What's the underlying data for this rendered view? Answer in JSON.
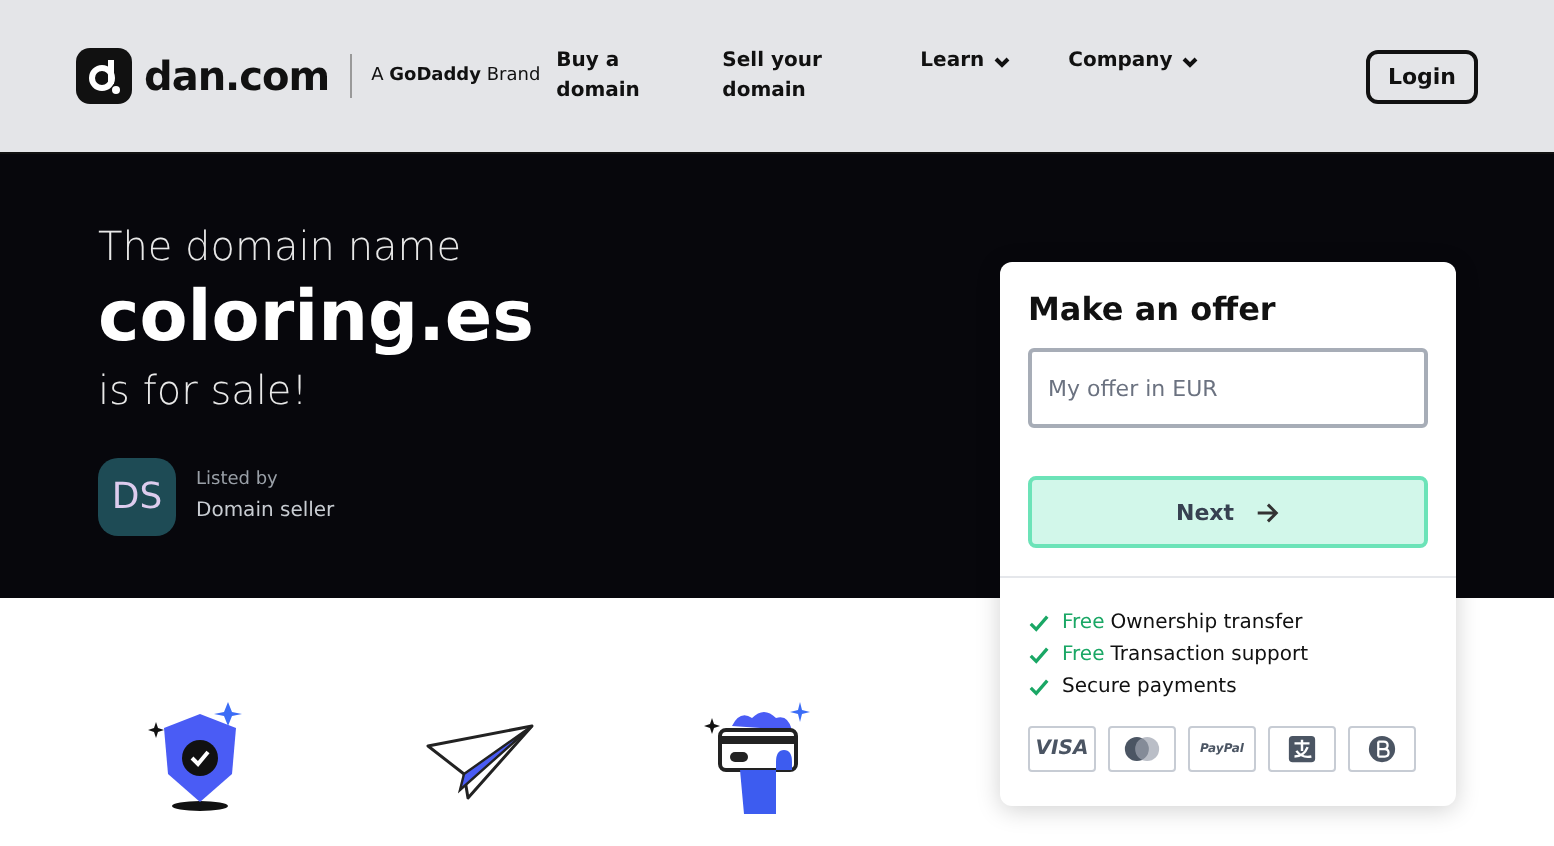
{
  "header": {
    "brand": "dan.com",
    "brand_tag": "A **GoDaddy** Brand",
    "nav": [
      {
        "label": "Buy a domain",
        "dropdown": false
      },
      {
        "label": "Sell your domain",
        "dropdown": false
      },
      {
        "label": "Learn",
        "dropdown": true
      },
      {
        "label": "Company",
        "dropdown": true
      }
    ],
    "login": "Login"
  },
  "hero": {
    "intro": "The domain name",
    "domain": "coloring.es",
    "outro": "is for sale!",
    "seller_initials": "DS",
    "listed_by": "Listed by",
    "seller": "Domain seller"
  },
  "offer": {
    "title": "Make an offer",
    "placeholder": "My offer in EUR",
    "next": "Next",
    "features": [
      {
        "free": "Free",
        "text": "Ownership transfer"
      },
      {
        "free": "Free",
        "text": "Transaction support"
      },
      {
        "text": "Secure payments"
      }
    ],
    "payments": [
      {
        "kind": "visa",
        "label": "VISA"
      },
      {
        "kind": "mastercard"
      },
      {
        "kind": "paypal",
        "label": "PayPal"
      },
      {
        "kind": "alipay"
      },
      {
        "kind": "bitcoin"
      }
    ]
  },
  "features": [
    {
      "kind": "shield"
    },
    {
      "kind": "plane"
    },
    {
      "kind": "card"
    }
  ]
}
